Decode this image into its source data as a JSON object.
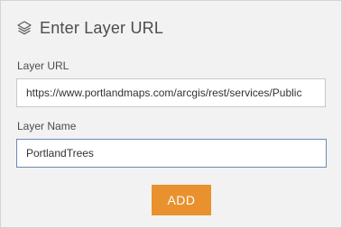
{
  "header": {
    "title": "Enter Layer URL",
    "icon": "layers-icon"
  },
  "layer_url": {
    "label": "Layer URL",
    "value": "https://www.portlandmaps.com/arcgis/rest/services/Public"
  },
  "layer_name": {
    "label": "Layer Name",
    "value": "PortlandTrees"
  },
  "add_button": {
    "label": "ADD",
    "color": "#e8912e"
  }
}
